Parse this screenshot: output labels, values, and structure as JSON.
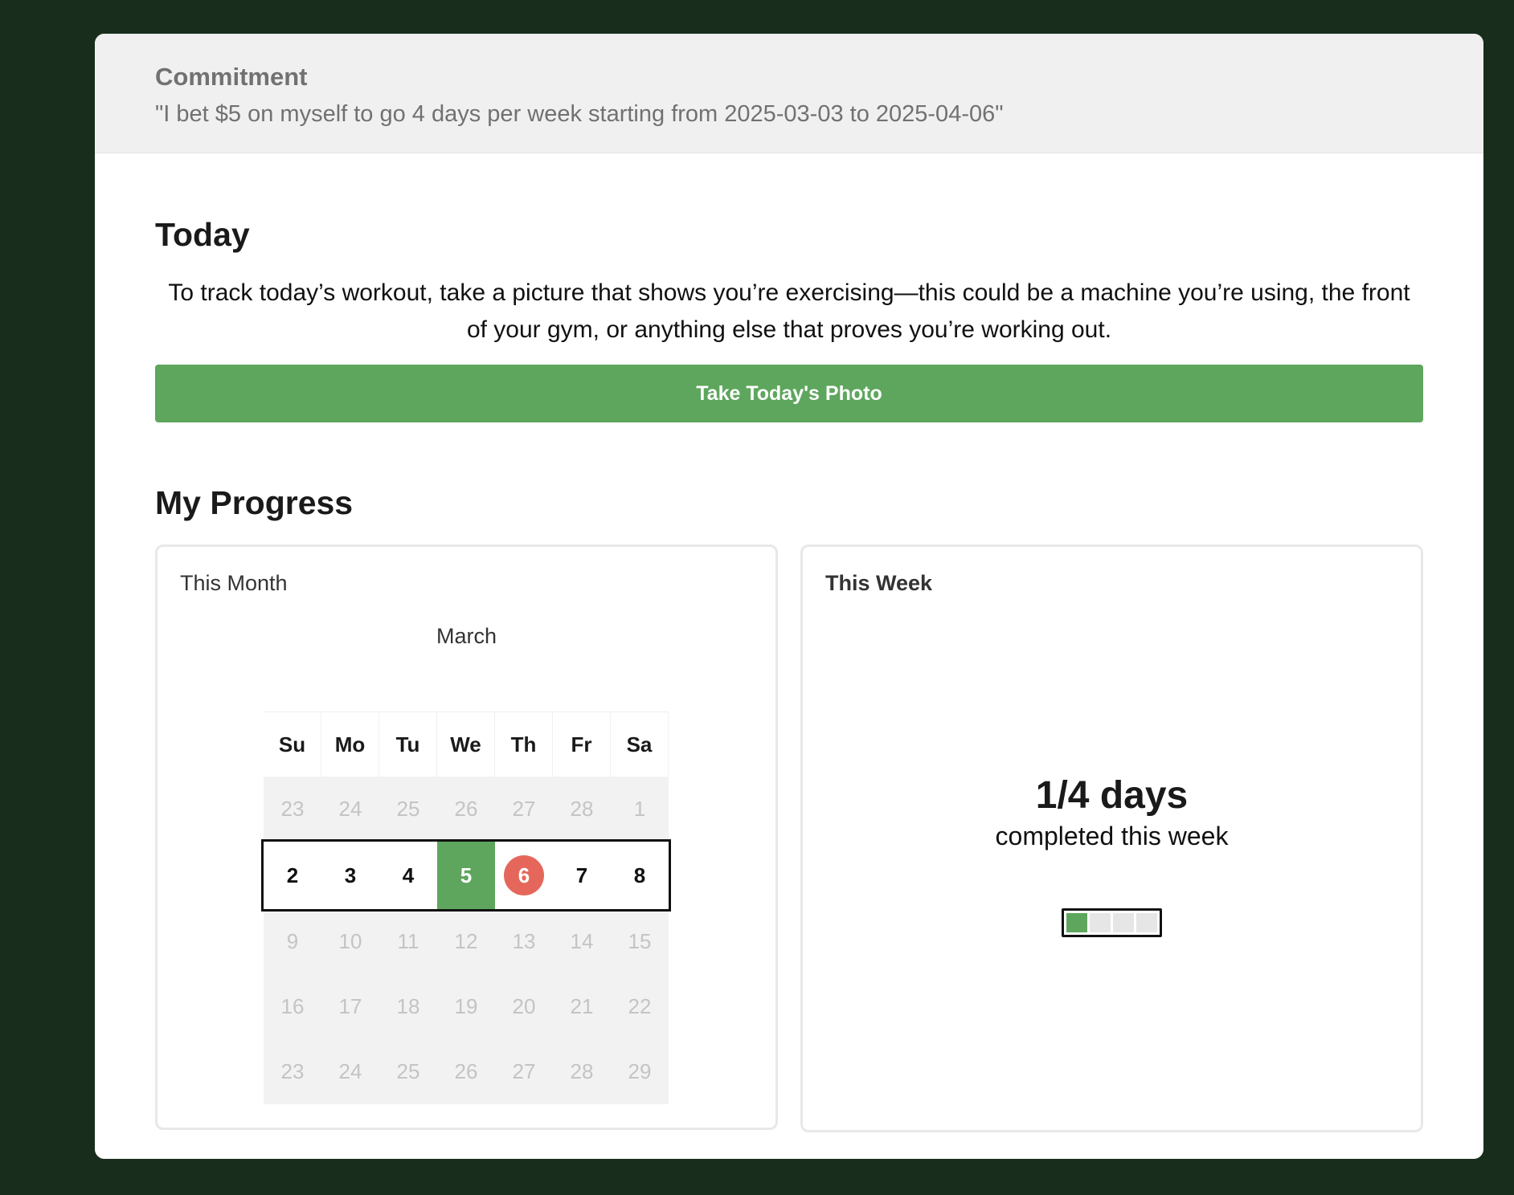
{
  "commitment": {
    "title": "Commitment",
    "text": "\"I bet $5 on myself to go 4 days per week starting from 2025-03-03 to 2025-04-06\""
  },
  "today": {
    "heading": "Today",
    "instructions": "To track today’s workout, take a picture that shows you’re exercising—this could be a machine you’re using, the front of your gym, or anything else that proves you’re working out.",
    "button_label": "Take Today's Photo"
  },
  "progress": {
    "heading": "My Progress",
    "month_panel": {
      "title": "This Month",
      "month_name": "March",
      "weekdays": [
        "Su",
        "Mo",
        "Tu",
        "We",
        "Th",
        "Fr",
        "Sa"
      ],
      "weeks": [
        [
          "23",
          "24",
          "25",
          "26",
          "27",
          "28",
          "1"
        ],
        [
          "2",
          "3",
          "4",
          "5",
          "6",
          "7",
          "8"
        ],
        [
          "9",
          "10",
          "11",
          "12",
          "13",
          "14",
          "15"
        ],
        [
          "16",
          "17",
          "18",
          "19",
          "20",
          "21",
          "22"
        ],
        [
          "23",
          "24",
          "25",
          "26",
          "27",
          "28",
          "29"
        ]
      ],
      "current_week_index": 1,
      "completed_days": [
        "5"
      ],
      "today": "6"
    },
    "week_panel": {
      "title": "This Week",
      "count": "1/4 days",
      "subtitle": "completed this week",
      "completed": 1,
      "goal": 4
    }
  },
  "colors": {
    "background": "#182d1c",
    "accent_green": "#5ea65d",
    "today_red": "#e5675b"
  }
}
